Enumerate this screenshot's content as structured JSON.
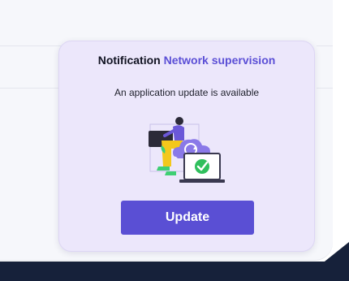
{
  "notification": {
    "title_prefix": "Notification",
    "title_accent": "Network supervision",
    "message": "An application update is available",
    "update_label": "Update",
    "illustration_icon": "person-laptop-cloud-update-icon"
  },
  "colors": {
    "card_background": "#ece7fb",
    "accent": "#5b4fd6",
    "button": "#5a4fd4",
    "dark_bar": "#16213a"
  }
}
